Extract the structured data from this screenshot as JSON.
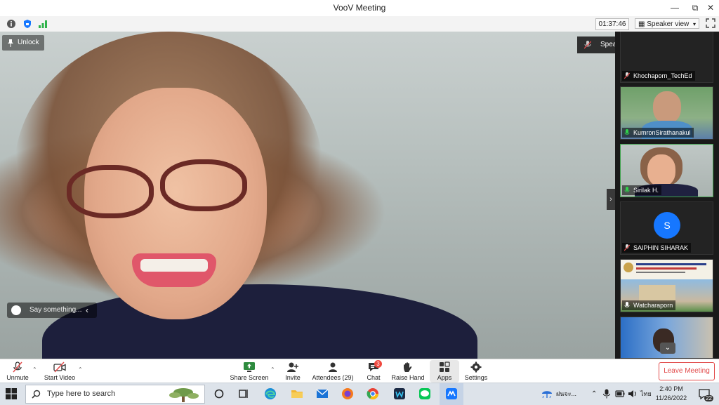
{
  "window": {
    "title": "VooV Meeting"
  },
  "infobar": {
    "timer": "01:37:46",
    "view_label": "Speaker view"
  },
  "overlay": {
    "unlock_label": "Unlock",
    "say_placeholder": "Say something...",
    "speaking_label": "Speaking: Sirilak H.; Ku..."
  },
  "participants": [
    {
      "name": "Khochaporn_TechEd",
      "muted": true
    },
    {
      "name": "KumronSirathanakul",
      "muted": false
    },
    {
      "name": "Sirilak H.",
      "muted": false
    },
    {
      "name": "SAIPHIN SIHARAK",
      "muted": true,
      "initial": "S"
    },
    {
      "name": "Watcharaporn",
      "muted": false
    }
  ],
  "toolbar": {
    "unmute": "Unmute",
    "start_video": "Start Video",
    "share_screen": "Share Screen",
    "invite": "Invite",
    "attendees": "Attendees (29)",
    "chat": "Chat",
    "chat_badge": "3",
    "raise_hand": "Raise Hand",
    "apps": "Apps",
    "settings": "Settings",
    "leave": "Leave Meeting"
  },
  "taskbar": {
    "search_placeholder": "Type here to search",
    "weather_text": "ฝนจะ...",
    "lang": "ไทย",
    "time": "2:40 PM",
    "date": "11/26/2022",
    "notification_count": "22"
  },
  "colors": {
    "accent": "#1677ff",
    "leave": "#e24b4b",
    "active_border": "#3fa34d",
    "badge": "#f0483e"
  }
}
